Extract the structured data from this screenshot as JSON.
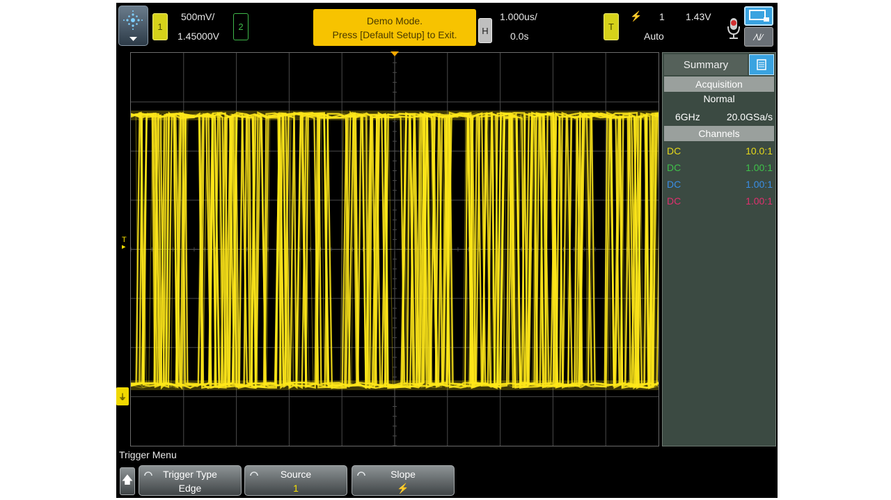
{
  "topbar": {
    "channel1": {
      "badge": "1",
      "scale": "500mV/",
      "offset": "1.45000V",
      "color": "#d6d21a"
    },
    "channel2": {
      "badge": "2",
      "color": "#3fb84a"
    },
    "demo": {
      "line1": "Demo Mode.",
      "line2": "Press [Default Setup] to Exit."
    },
    "horizontal": {
      "badge": "H",
      "timebase": "1.000us/",
      "delay": "0.0s"
    },
    "trigger": {
      "badge": "T",
      "slope_glyph": "⚡",
      "source": "1",
      "level": "1.43V",
      "mode": "Auto"
    },
    "icons": [
      "menu-icon",
      "microphone-icon",
      "run-stop-icon",
      "measure-icon"
    ],
    "measure_label": "⁄\\/⁄"
  },
  "markers": {
    "trigger_level": "T",
    "ground": "⏚"
  },
  "summary": {
    "tab": "Summary",
    "acquisition_header": "Acquisition",
    "mode": "Normal",
    "bandwidth": "6GHz",
    "sample_rate": "20.0GSa/s",
    "channels_header": "Channels",
    "channels": [
      {
        "coupling": "DC",
        "probe": "10.0:1",
        "color": "#e6d81a"
      },
      {
        "coupling": "DC",
        "probe": "1.00:1",
        "color": "#3fc14a"
      },
      {
        "coupling": "DC",
        "probe": "1.00:1",
        "color": "#3a8ee6"
      },
      {
        "coupling": "DC",
        "probe": "1.00:1",
        "color": "#e0306e"
      }
    ]
  },
  "softkeys": {
    "menu_title": "Trigger Menu",
    "keys": [
      {
        "label": "Trigger Type",
        "value": "Edge"
      },
      {
        "label": "Source",
        "value": "1"
      },
      {
        "label": "Slope",
        "value": "⚡"
      }
    ]
  },
  "waveform_color": "#ffe81a"
}
